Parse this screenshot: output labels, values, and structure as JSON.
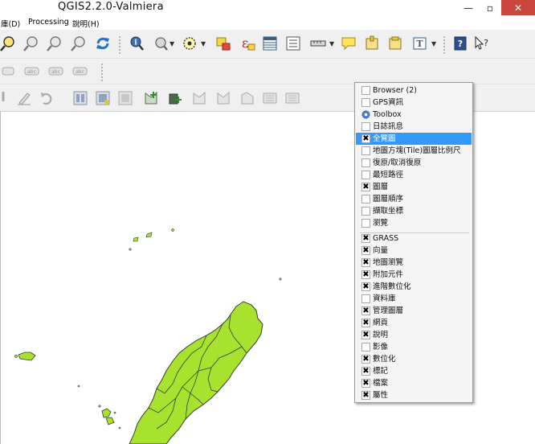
{
  "window": {
    "title": "QGIS2.2.0-Valmiera"
  },
  "menubar": {
    "items": [
      "庫(D)",
      "Processing",
      "說明(H)"
    ]
  },
  "context_menu": {
    "panels": [
      {
        "label": "Browser (2)",
        "checked": false
      },
      {
        "label": "GPS資訊",
        "checked": false
      },
      {
        "label": "Toolbox",
        "checked": false,
        "icon": "gear-icon"
      },
      {
        "label": "日誌訊息",
        "checked": false
      },
      {
        "label": "全覽圖",
        "checked": true,
        "highlighted": true
      },
      {
        "label": "地圖方塊(Tile)圖層比例尺",
        "checked": false
      },
      {
        "label": "復原/取消復原",
        "checked": false
      },
      {
        "label": "最短路徑",
        "checked": false
      },
      {
        "label": "圖層",
        "checked": true
      },
      {
        "label": "圖層順序",
        "checked": false
      },
      {
        "label": "擷取坐標",
        "checked": false
      },
      {
        "label": "瀏覽",
        "checked": false
      }
    ],
    "toolbars": [
      {
        "label": "GRASS",
        "checked": true
      },
      {
        "label": "向量",
        "checked": true
      },
      {
        "label": "地圖瀏覽",
        "checked": true
      },
      {
        "label": "附加元件",
        "checked": true
      },
      {
        "label": "進階數位化",
        "checked": true
      },
      {
        "label": "資料庫",
        "checked": false
      },
      {
        "label": "管理圖層",
        "checked": true
      },
      {
        "label": "網頁",
        "checked": true
      },
      {
        "label": "說明",
        "checked": true
      },
      {
        "label": "影像",
        "checked": false
      },
      {
        "label": "數位化",
        "checked": true
      },
      {
        "label": "標記",
        "checked": true
      },
      {
        "label": "檔案",
        "checked": true
      },
      {
        "label": "屬性",
        "checked": true
      }
    ]
  },
  "map": {
    "fill_color": "#a6e22e",
    "stroke_color": "#3a3a3a",
    "layer": "Taiwan"
  },
  "colors": {
    "highlight": "#3399ff",
    "close_button": "#c9463d"
  },
  "check_mark": "✖"
}
